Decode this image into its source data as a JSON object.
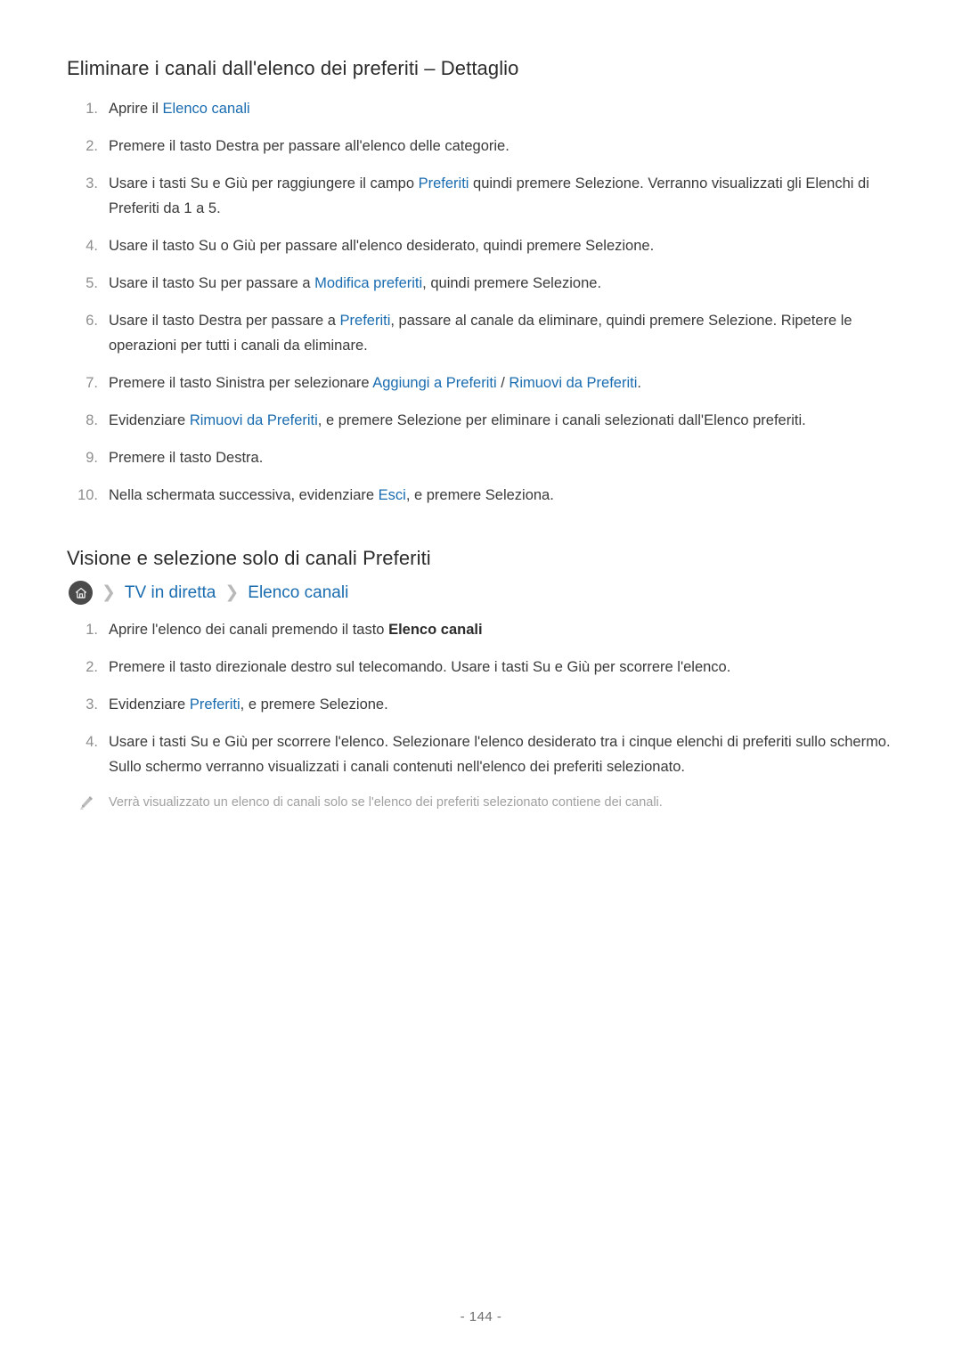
{
  "document": {
    "page_number": "- 144 -"
  },
  "section_one": {
    "heading": "Eliminare i canali dall'elenco dei preferiti – Dettaglio",
    "steps": [
      {
        "number": "1.",
        "parts": [
          {
            "text": "Aprire il ",
            "style": "plain"
          },
          {
            "text": "Elenco canali",
            "style": "link"
          }
        ]
      },
      {
        "number": "2.",
        "parts": [
          {
            "text": "Premere il tasto Destra per passare all'elenco delle categorie.",
            "style": "plain"
          }
        ]
      },
      {
        "number": "3.",
        "parts": [
          {
            "text": "Usare i tasti Su e Giù per raggiungere il campo ",
            "style": "plain"
          },
          {
            "text": "Preferiti",
            "style": "link"
          },
          {
            "text": " quindi premere Selezione. Verranno visualizzati gli Elenchi di Preferiti da 1 a 5.",
            "style": "plain"
          }
        ]
      },
      {
        "number": "4.",
        "parts": [
          {
            "text": "Usare il tasto Su o Giù per passare all'elenco desiderato, quindi premere Selezione.",
            "style": "plain"
          }
        ]
      },
      {
        "number": "5.",
        "parts": [
          {
            "text": "Usare il tasto Su per passare a ",
            "style": "plain"
          },
          {
            "text": "Modifica preferiti",
            "style": "link"
          },
          {
            "text": ", quindi premere Selezione.",
            "style": "plain"
          }
        ]
      },
      {
        "number": "6.",
        "parts": [
          {
            "text": "Usare il tasto Destra per passare a ",
            "style": "plain"
          },
          {
            "text": "Preferiti",
            "style": "link"
          },
          {
            "text": ", passare al canale da eliminare, quindi premere Selezione. Ripetere le operazioni per tutti i canali da eliminare.",
            "style": "plain"
          }
        ]
      },
      {
        "number": "7.",
        "parts": [
          {
            "text": "Premere il tasto Sinistra per selezionare ",
            "style": "plain"
          },
          {
            "text": "Aggiungi a Preferiti",
            "style": "link"
          },
          {
            "text": " / ",
            "style": "plain"
          },
          {
            "text": "Rimuovi da Preferiti",
            "style": "link"
          },
          {
            "text": ".",
            "style": "plain"
          }
        ]
      },
      {
        "number": "8.",
        "parts": [
          {
            "text": "Evidenziare ",
            "style": "plain"
          },
          {
            "text": "Rimuovi da Preferiti",
            "style": "link"
          },
          {
            "text": ", e premere Selezione per eliminare i canali selezionati dall'Elenco preferiti.",
            "style": "plain"
          }
        ]
      },
      {
        "number": "9.",
        "parts": [
          {
            "text": "Premere il tasto Destra.",
            "style": "plain"
          }
        ]
      },
      {
        "number": "10.",
        "parts": [
          {
            "text": "Nella schermata successiva, evidenziare ",
            "style": "plain"
          },
          {
            "text": "Esci",
            "style": "link"
          },
          {
            "text": ", e premere Seleziona.",
            "style": "plain"
          }
        ]
      }
    ]
  },
  "section_two": {
    "heading": "Visione e selezione solo di canali Preferiti",
    "breadcrumb": {
      "home_icon": "home-icon",
      "separator": "❯",
      "items": [
        {
          "label": "TV in diretta"
        },
        {
          "label": "Elenco canali"
        }
      ]
    },
    "steps": [
      {
        "number": "1.",
        "parts": [
          {
            "text": "Aprire l'elenco dei canali premendo il tasto ",
            "style": "plain"
          },
          {
            "text": "Elenco canali",
            "style": "bold"
          }
        ]
      },
      {
        "number": "2.",
        "parts": [
          {
            "text": "Premere il tasto direzionale destro sul telecomando. Usare i tasti Su e Giù per scorrere l'elenco.",
            "style": "plain"
          }
        ]
      },
      {
        "number": "3.",
        "parts": [
          {
            "text": "Evidenziare ",
            "style": "plain"
          },
          {
            "text": "Preferiti",
            "style": "link"
          },
          {
            "text": ", e premere Selezione.",
            "style": "plain"
          }
        ]
      },
      {
        "number": "4.",
        "parts": [
          {
            "text": "Usare i tasti Su e Giù per scorrere l'elenco. Selezionare l'elenco desiderato tra i cinque elenchi di preferiti sullo schermo. Sullo schermo verranno visualizzati i canali contenuti nell'elenco dei preferiti selezionato.",
            "style": "plain"
          }
        ]
      }
    ],
    "note": {
      "icon": "pencil-icon",
      "text": "Verrà visualizzato un elenco di canali solo se l'elenco dei preferiti selezionato contiene dei canali."
    }
  },
  "colors": {
    "link": "#1a6cb0",
    "body_text": "#3a3a3a",
    "heading_text": "#2b2b2b",
    "number_text": "#8e8e8e",
    "note_text": "#a0a0a0",
    "home_icon_bg": "#4a4a4a"
  }
}
